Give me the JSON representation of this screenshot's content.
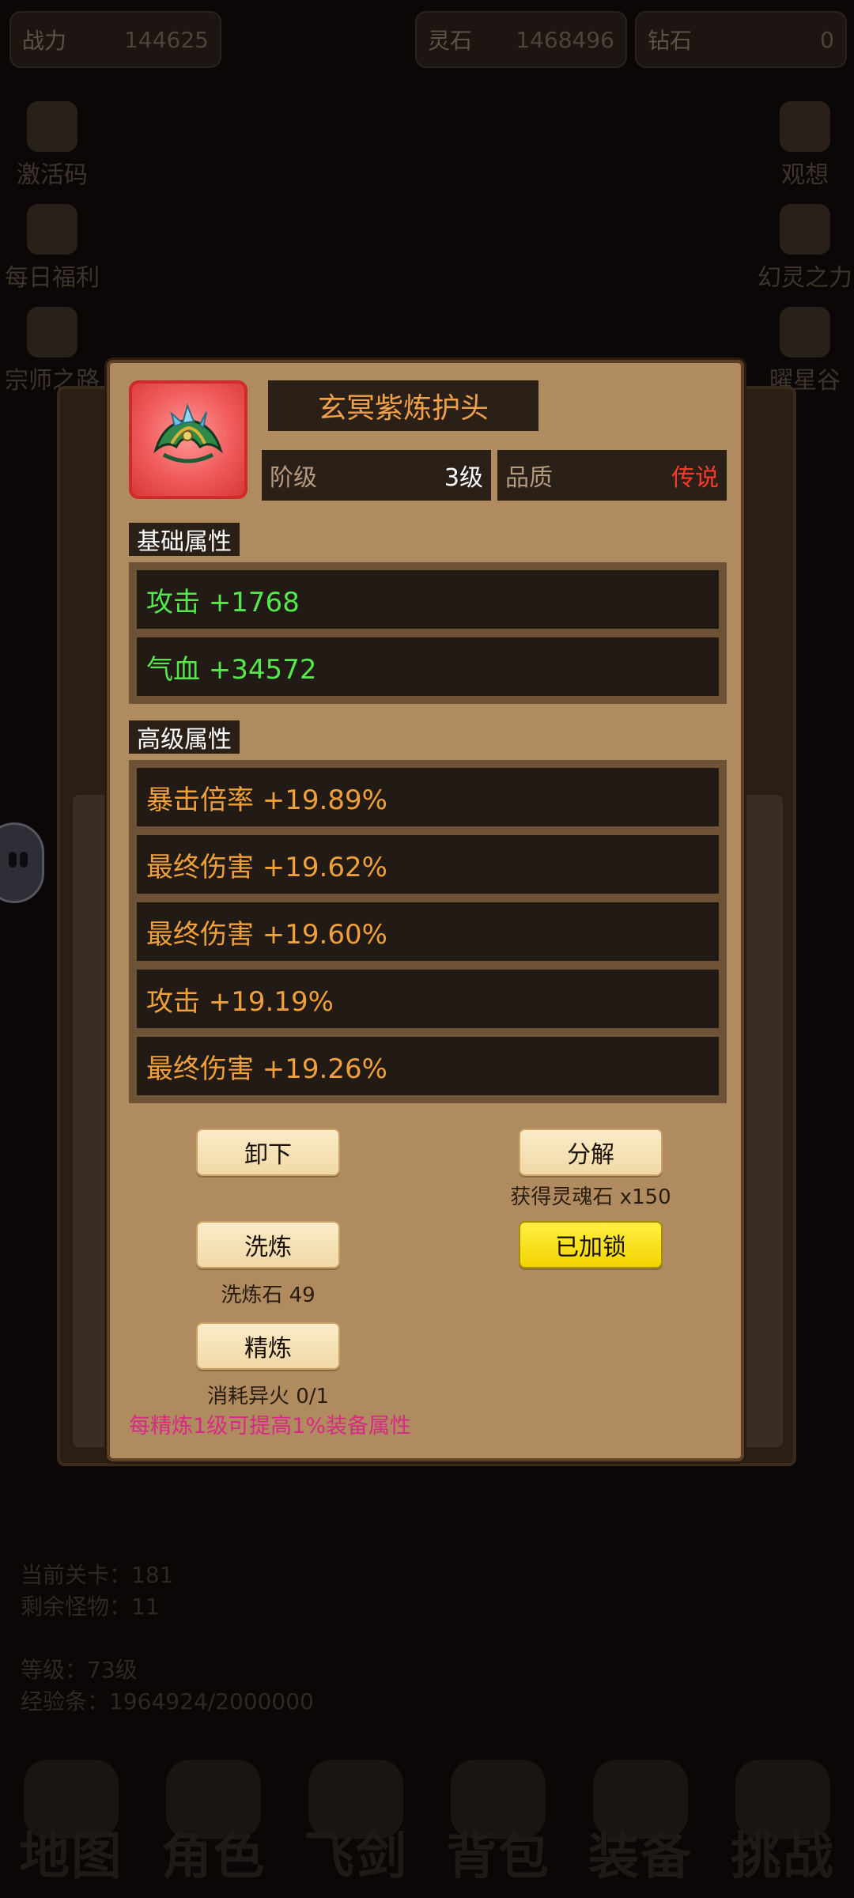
{
  "topbar": {
    "power": {
      "label": "战力",
      "value": "144625"
    },
    "spirit_stone": {
      "label": "灵石",
      "value": "1468496"
    },
    "diamond": {
      "label": "钻石",
      "value": "0"
    }
  },
  "left_menu": [
    "激活码",
    "每日福利",
    "宗师之路"
  ],
  "right_menu": [
    "观想",
    "幻灵之力",
    "曜星谷"
  ],
  "background_info": {
    "level_stage": "当前关卡：181",
    "remaining_monsters": "剩余怪物：11",
    "player_level": "等级：73级",
    "exp_bar": "经验条：1964924/2000000"
  },
  "bottom_nav": [
    "地图",
    "角色",
    "飞剑",
    "背包",
    "装备",
    "挑战"
  ],
  "dialog": {
    "item_name": "玄冥紫炼护头",
    "tier_label": "阶级",
    "tier_value": "3级",
    "quality_label": "品质",
    "quality_value": "传说",
    "base_title": "基础属性",
    "base_attrs": [
      "攻击 +1768",
      "气血 +34572"
    ],
    "advanced_title": "高级属性",
    "advanced_attrs": [
      "暴击倍率 +19.89%",
      "最终伤害 +19.62%",
      "最终伤害 +19.60%",
      "攻击 +19.19%",
      "最终伤害 +19.26%"
    ],
    "buttons": {
      "unequip": "卸下",
      "decompose": "分解",
      "reforge": "洗炼",
      "lock": "已加锁",
      "refine": "精炼"
    },
    "decompose_reward": "获得灵魂石 x150",
    "reforge_cost": "洗炼石 49",
    "refine_cost": "消耗异火 0/1",
    "refine_tip": "每精炼1级可提高1%装备属性"
  },
  "colors": {
    "quality_legend": "#ff3a2a",
    "base_attr": "#55e84a",
    "advanced_attr": "#f0a03a",
    "locked_button": "#f2d400"
  }
}
